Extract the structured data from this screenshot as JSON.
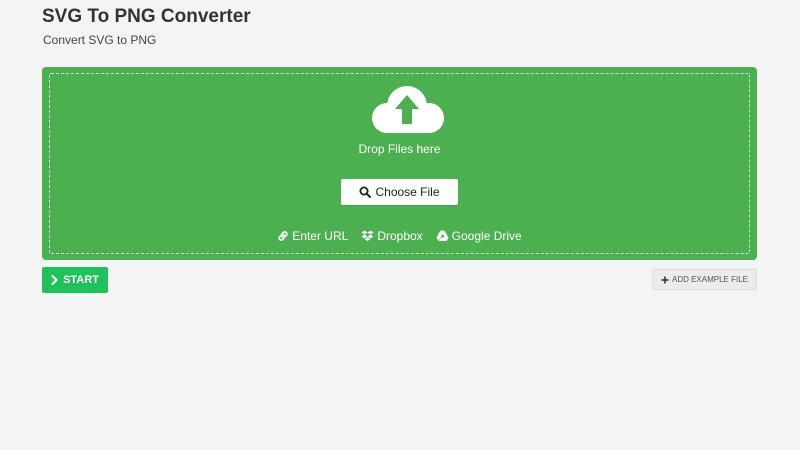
{
  "header": {
    "title": "SVG To PNG Converter",
    "subtitle": "Convert SVG to PNG"
  },
  "dropzone": {
    "icon": "cloud-upload-icon",
    "drop_text": "Drop Files here",
    "choose_file_label": "Choose File",
    "sources": [
      {
        "label": "Enter URL",
        "icon": "link-icon"
      },
      {
        "label": "Dropbox",
        "icon": "dropbox-icon"
      },
      {
        "label": "Google Drive",
        "icon": "google-drive-icon"
      }
    ],
    "background_color": "#4caf50"
  },
  "actions": {
    "start_label": "START",
    "start_color": "#20c05b",
    "add_example_label": "ADD EXAMPLE FILE"
  }
}
